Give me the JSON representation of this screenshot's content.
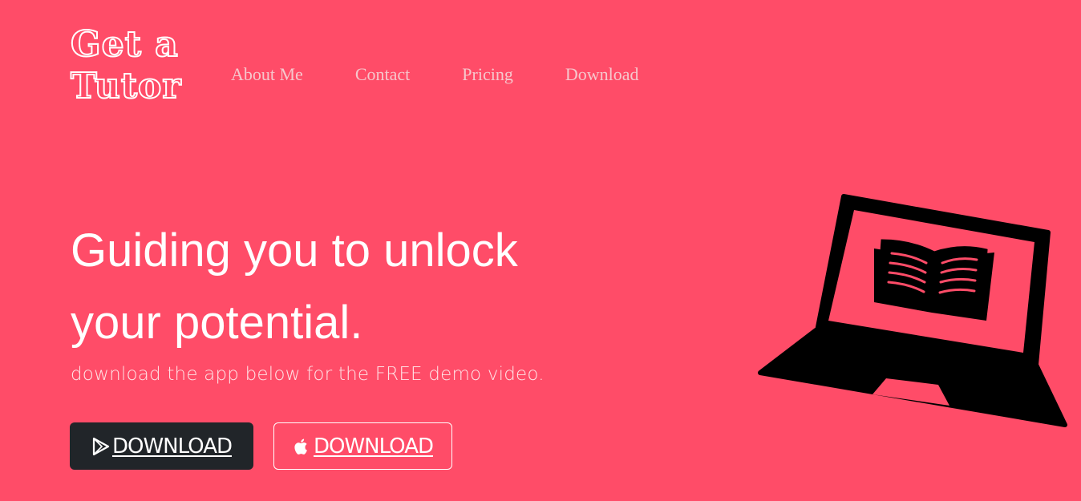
{
  "brand": {
    "line1": "Get a",
    "line2": "Tutor"
  },
  "nav": {
    "items": [
      "About Me",
      "Contact",
      "Pricing",
      "Download"
    ]
  },
  "hero": {
    "headline_line1": "Guiding you to unlock",
    "headline_line2": "your potential.",
    "subtitle": "download the app below for the FREE demo video.",
    "google_play_button": "DOWNLOAD",
    "app_store_button": "DOWNLOAD"
  },
  "icons": {
    "google_play": "play-store-icon",
    "app_store": "apple-icon",
    "illustration": "laptop-book-icon"
  },
  "colors": {
    "background": "#ff4c68",
    "dark_button": "#212529",
    "text": "#ffffff"
  }
}
